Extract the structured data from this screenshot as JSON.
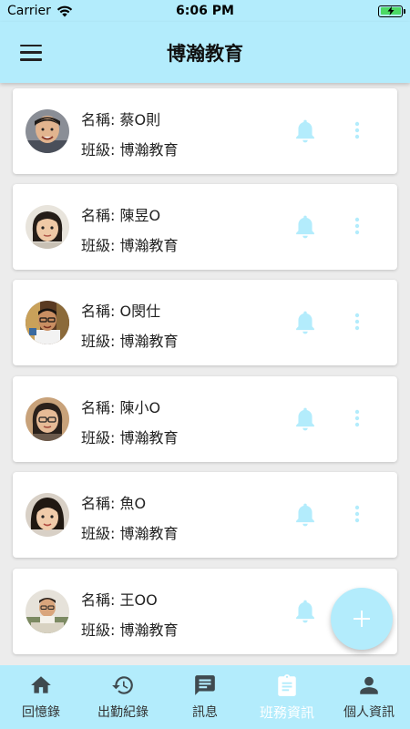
{
  "status_bar": {
    "carrier": "Carrier",
    "time": "6:06 PM"
  },
  "app_bar": {
    "title": "博瀚教育"
  },
  "students": [
    {
      "name": "名稱: 蔡O則",
      "class": "班級: 博瀚教育"
    },
    {
      "name": "名稱: 陳昱O",
      "class": "班級: 博瀚教育"
    },
    {
      "name": "名稱: O閔仕",
      "class": "班級: 博瀚教育"
    },
    {
      "name": "名稱: 陳小O",
      "class": "班級: 博瀚教育"
    },
    {
      "name": "名稱: 魚O",
      "class": "班級: 博瀚教育"
    },
    {
      "name": "名稱: 王OO",
      "class": "班級: 博瀚教育"
    }
  ],
  "bottom_nav": [
    {
      "label": "回憶錄",
      "icon": "home-icon",
      "active": false
    },
    {
      "label": "出勤紀錄",
      "icon": "history-icon",
      "active": false
    },
    {
      "label": "訊息",
      "icon": "message-icon",
      "active": false
    },
    {
      "label": "班務資訊",
      "icon": "clipboard-icon",
      "active": true
    },
    {
      "label": "個人資訊",
      "icon": "person-icon",
      "active": false
    }
  ],
  "colors": {
    "accent": "#b3ecfc",
    "icon": "#b3ecfc",
    "nav_icon": "#3f4a4f"
  }
}
